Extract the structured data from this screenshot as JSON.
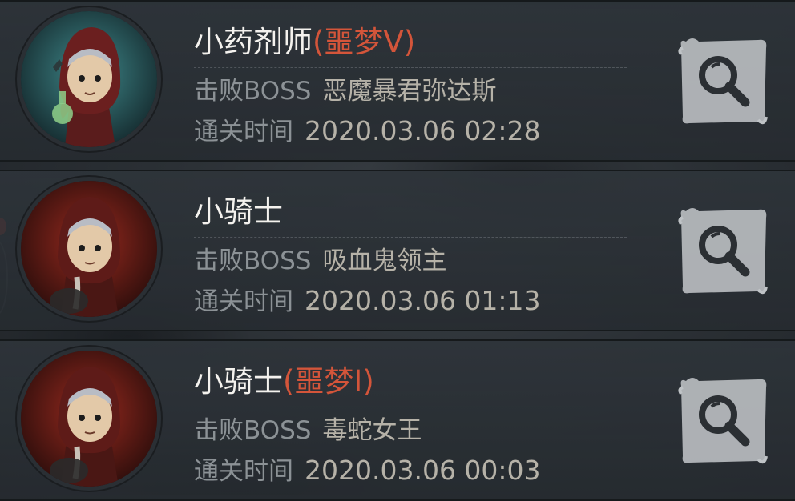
{
  "records": [
    {
      "character": "小药剂师",
      "difficulty_tag": "(噩梦V)",
      "boss_label": "击败BOSS",
      "boss_name": "恶魔暴君弥达斯",
      "time_label": "通关时间",
      "time_value": "2020.03.06 02:28",
      "avatar": "alchemist-portrait",
      "avatar_bg": "#2f6f73"
    },
    {
      "character": "小骑士",
      "difficulty_tag": "",
      "boss_label": "击败BOSS",
      "boss_name": "吸血鬼领主",
      "time_label": "通关时间",
      "time_value": "2020.03.06 01:13",
      "avatar": "knight-portrait",
      "avatar_bg": "#7a1f18"
    },
    {
      "character": "小骑士",
      "difficulty_tag": "(噩梦I)",
      "boss_label": "击败BOSS",
      "boss_name": "毒蛇女王",
      "time_label": "通关时间",
      "time_value": "2020.03.06 00:03",
      "avatar": "knight-portrait",
      "avatar_bg": "#7a1f18"
    }
  ],
  "search_icon": "magnifier-icon",
  "colors": {
    "name": "#f4f2ee",
    "tag": "#d4553a",
    "label": "#8c9296",
    "value": "#b6b2a8",
    "button": "#bfc3c6"
  }
}
